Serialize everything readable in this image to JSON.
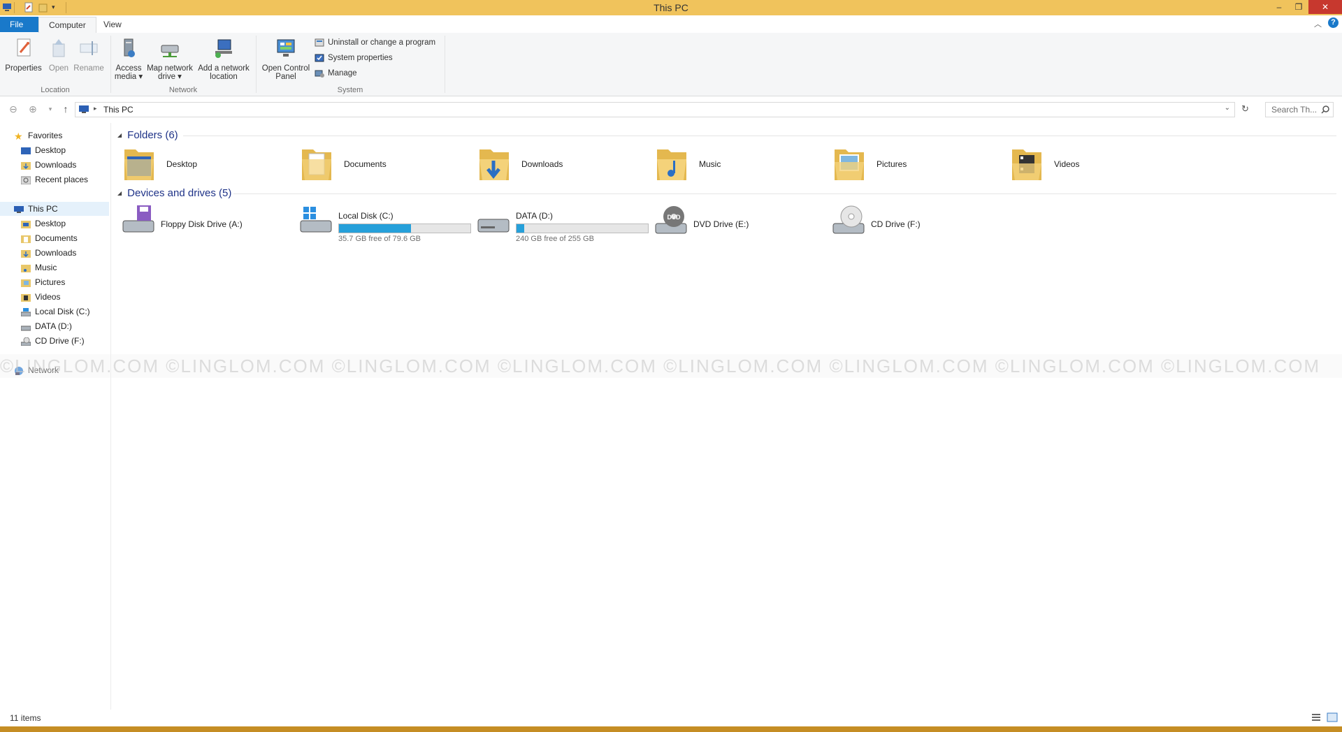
{
  "window": {
    "title": "This PC"
  },
  "tabs": {
    "file": "File",
    "computer": "Computer",
    "view": "View"
  },
  "ribbon": {
    "location": {
      "label": "Location",
      "properties": "Properties",
      "open": "Open",
      "rename": "Rename"
    },
    "network": {
      "label": "Network",
      "access_media_1": "Access",
      "access_media_2": "media",
      "map_drive_1": "Map network",
      "map_drive_2": "drive",
      "add_location_1": "Add a network",
      "add_location_2": "location"
    },
    "system": {
      "label": "System",
      "control_panel_1": "Open Control",
      "control_panel_2": "Panel",
      "uninstall": "Uninstall or change a program",
      "sys_props": "System properties",
      "manage": "Manage"
    }
  },
  "address": {
    "crumb": "This PC",
    "search_placeholder": "Search Th..."
  },
  "nav": {
    "favorites": "Favorites",
    "fav_items": [
      "Desktop",
      "Downloads",
      "Recent places"
    ],
    "this_pc": "This PC",
    "pc_items": [
      "Desktop",
      "Documents",
      "Downloads",
      "Music",
      "Pictures",
      "Videos",
      "Local Disk (C:)",
      "DATA (D:)",
      "CD Drive (F:)"
    ],
    "network": "Network"
  },
  "folders": {
    "heading": "Folders (6)",
    "items": [
      "Desktop",
      "Documents",
      "Downloads",
      "Music",
      "Pictures",
      "Videos"
    ]
  },
  "drives": {
    "heading": "Devices and drives (5)",
    "items": [
      {
        "name": "Floppy Disk Drive (A:)"
      },
      {
        "name": "Local Disk (C:)",
        "free": "35.7 GB free of 79.6 GB",
        "used_fraction": 0.55
      },
      {
        "name": "DATA (D:)",
        "free": "240 GB free of 255 GB",
        "used_fraction": 0.06
      },
      {
        "name": "DVD Drive (E:)",
        "badge": "DVD"
      },
      {
        "name": "CD Drive (F:)"
      }
    ]
  },
  "status": {
    "count": "11 items"
  },
  "watermark": "©LINGLOM.COM   ©LINGLOM.COM   ©LINGLOM.COM   ©LINGLOM.COM   ©LINGLOM.COM   ©LINGLOM.COM   ©LINGLOM.COM   ©LINGLOM.COM",
  "colors": {
    "titlebar": "#f0c35c",
    "accent": "#1979ca",
    "progress": "#26a0da",
    "section": "#1e3287"
  }
}
